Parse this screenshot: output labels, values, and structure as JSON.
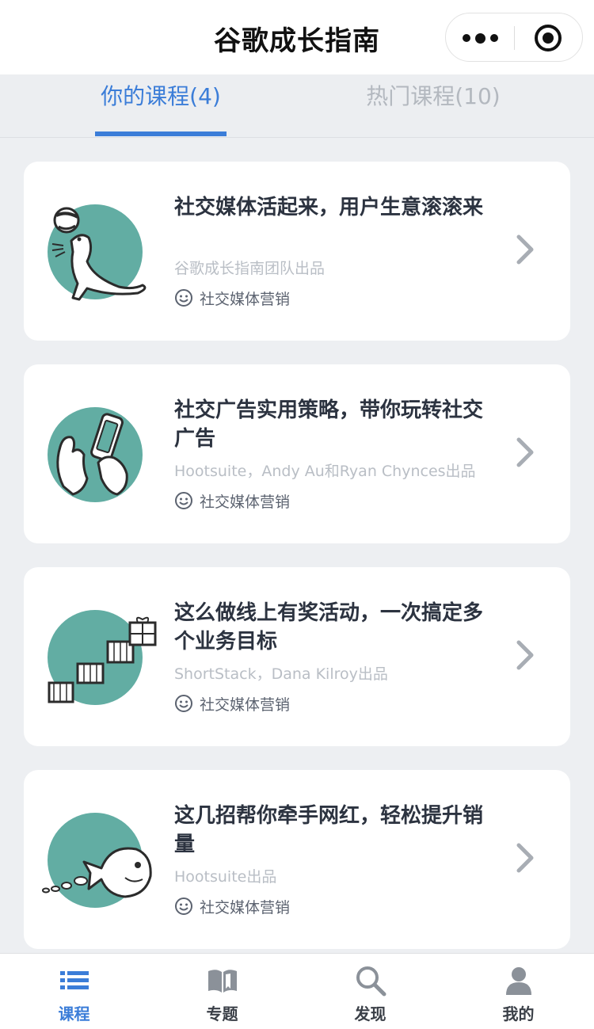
{
  "header": {
    "title": "谷歌成长指南",
    "more_icon": "more-dots-icon",
    "close_icon": "target-close-icon"
  },
  "tabs": [
    {
      "label": "你的课程(4)",
      "active": true
    },
    {
      "label": "热门课程(10)",
      "active": false
    }
  ],
  "courses": [
    {
      "title": "社交媒体活起来，用户生意滚滚来",
      "author": "谷歌成长指南团队出品",
      "tag": "社交媒体营销",
      "illustration": "seal-with-ball-icon"
    },
    {
      "title": "社交广告实用策略，带你玩转社交广告",
      "author": "Hootsuite，Andy Au和Ryan Chynces出品",
      "tag": "社交媒体营销",
      "illustration": "hands-with-phone-icon"
    },
    {
      "title": "这么做线上有奖活动，一次搞定多个业务目标",
      "author": "ShortStack，Dana Kilroy出品",
      "tag": "社交媒体营销",
      "illustration": "gift-boxes-stairs-icon"
    },
    {
      "title": "这几招帮你牵手网红，轻松提升销量",
      "author": "Hootsuite出品",
      "tag": "社交媒体营销",
      "illustration": "fish-chasing-fish-icon"
    }
  ],
  "bottom_nav": [
    {
      "label": "课程",
      "icon": "list-icon",
      "active": true
    },
    {
      "label": "专题",
      "icon": "book-icon",
      "active": false
    },
    {
      "label": "发现",
      "icon": "search-icon",
      "active": false
    },
    {
      "label": "我的",
      "icon": "user-icon",
      "active": false
    }
  ],
  "colors": {
    "accent": "#3b7dd8",
    "thumb_bg": "#62ada3",
    "page_bg": "#edeff2"
  }
}
